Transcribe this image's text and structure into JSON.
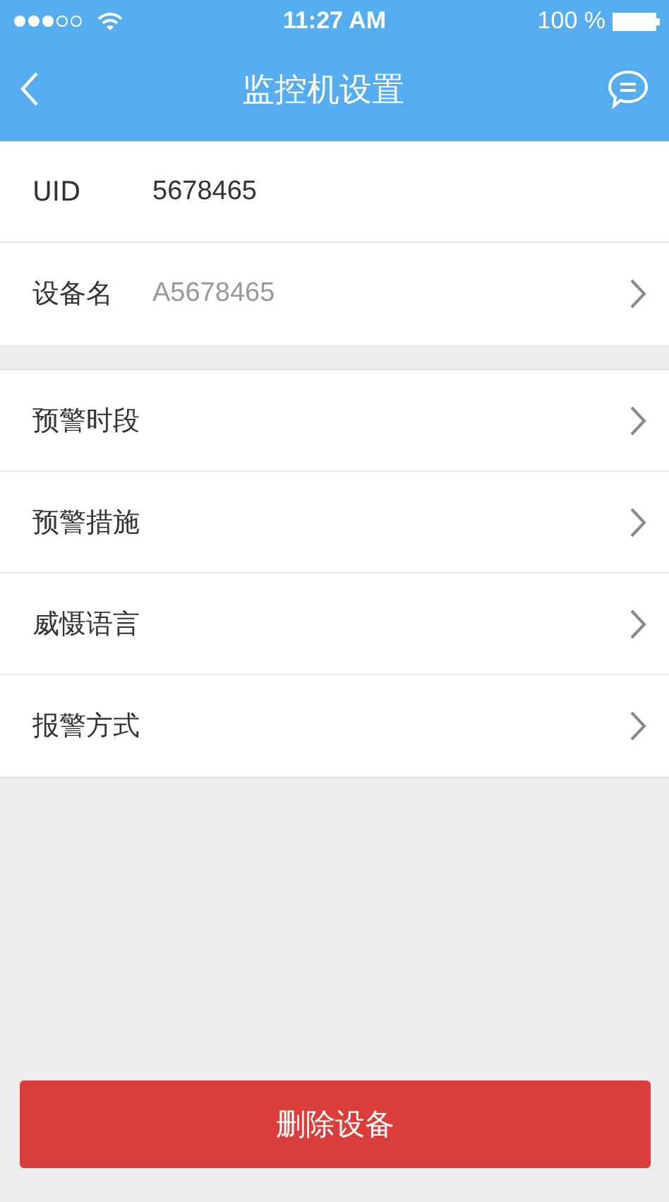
{
  "status_bar": {
    "time": "11:27 AM",
    "battery": "100 %"
  },
  "nav_bar": {
    "title": "监控机设置"
  },
  "device_info": [
    {
      "kind": "static",
      "label": "UID",
      "value": "5678465"
    },
    {
      "kind": "link",
      "label": "设备名",
      "value": "A5678465"
    }
  ],
  "settings": [
    {
      "label": "预警时段"
    },
    {
      "label": "预警措施"
    },
    {
      "label": "威慑语言"
    },
    {
      "label": "报警方式"
    }
  ],
  "delete_button": "删除设备"
}
